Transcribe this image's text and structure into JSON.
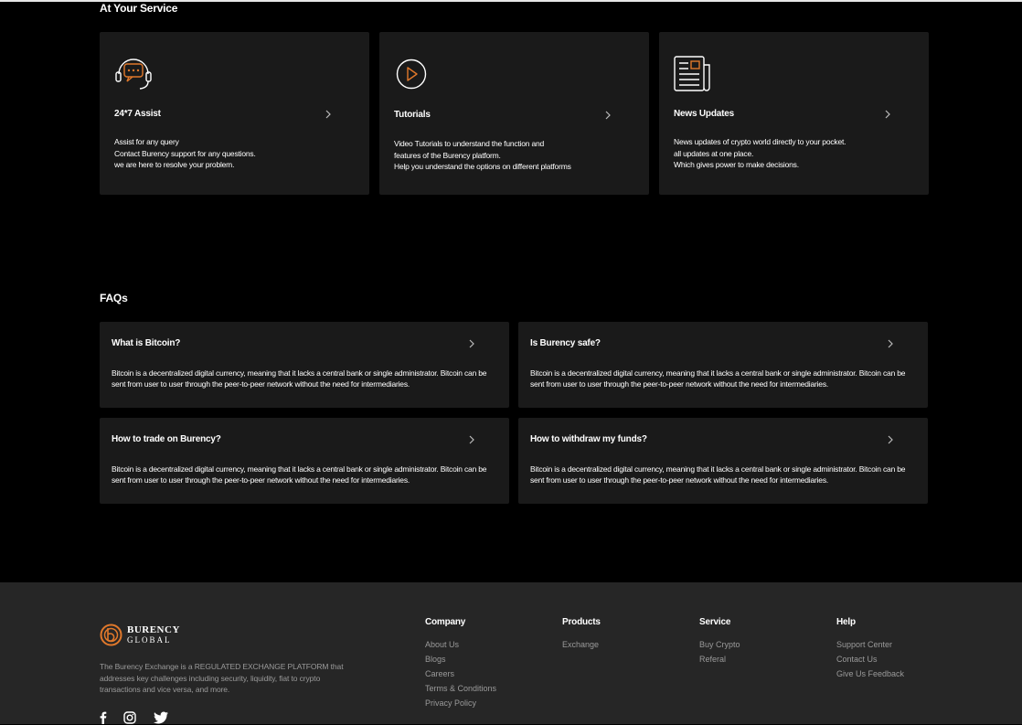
{
  "services": {
    "title": "At Your Service",
    "cards": [
      {
        "title": "24*7 Assist",
        "icon": "support-chat-icon",
        "description": "Assist for any query\nContact Burency support for any questions.\nwe are here to resolve your problem."
      },
      {
        "title": "Tutorials",
        "icon": "play-icon",
        "description": "Video Tutorials to understand the function and\nfeatures of the Burency platform.\nHelp you understand the options on different platforms"
      },
      {
        "title": "News Updates",
        "icon": "newspaper-icon",
        "description": "News updates of crypto world directly to your pocket.\nall updates at one place.\nWhich gives power to make decisions."
      }
    ]
  },
  "faqs": {
    "title": "FAQs",
    "items": [
      {
        "question": "What is Bitcoin?",
        "answer": "Bitcoin is a decentralized digital currency, meaning that it lacks a central bank or single administrator. Bitcoin can be sent from user to user through the peer-to-peer network without the need for intermediaries."
      },
      {
        "question": "Is Burency safe?",
        "answer": "Bitcoin is a decentralized digital currency, meaning that it lacks a central bank or single administrator. Bitcoin can be sent from user to user through the peer-to-peer network without the need for intermediaries."
      },
      {
        "question": "How to trade on Burency?",
        "answer": "Bitcoin is a decentralized digital currency, meaning that it lacks a central bank or single administrator. Bitcoin can be sent from user to user through the peer-to-peer network without the need for intermediaries."
      },
      {
        "question": "How to withdraw my funds?",
        "answer": "Bitcoin is a decentralized digital currency, meaning that it lacks a central bank or single administrator. Bitcoin can be sent from user to user through the peer-to-peer network without the need for intermediaries."
      }
    ]
  },
  "footer": {
    "logo_line1": "BURENCY",
    "logo_line2": "GLOBAL",
    "about": "The Burency Exchange is a REGULATED EXCHANGE PLATFORM that addresses key challenges including security, liquidity, fiat to crypto transactions and vice versa, and more.",
    "social_icons": [
      "facebook-icon",
      "instagram-icon",
      "twitter-icon"
    ],
    "columns": [
      {
        "heading": "Company",
        "links": [
          "About Us",
          "Blogs",
          "Careers",
          "Terms & Conditions",
          "Privacy Policy"
        ]
      },
      {
        "heading": "Products",
        "links": [
          "Exchange"
        ]
      },
      {
        "heading": "Service",
        "links": [
          "Buy Crypto",
          "Referal"
        ]
      },
      {
        "heading": "Help",
        "links": [
          "Support Center",
          "Contact Us",
          "Give Us Feedback"
        ]
      }
    ]
  },
  "colors": {
    "accent": "#e0782b",
    "card_bg": "#1a1a1a",
    "footer_bg": "#262626",
    "muted_text": "#9a9a9a"
  }
}
